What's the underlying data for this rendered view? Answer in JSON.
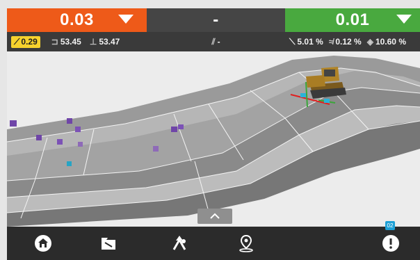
{
  "header": {
    "left": {
      "main_value": "0.03",
      "sub": {
        "badge_value": "0.29",
        "value_a": "53.45",
        "value_b": "53.47"
      },
      "color": "#ee5a19"
    },
    "middle": {
      "main_value": "-",
      "sub_value": "-"
    },
    "right": {
      "main_value": "0.01",
      "sub": {
        "value_a": "5.01 %",
        "value_b": "0.12 %",
        "value_c": "10.60 %"
      },
      "color": "#49a93f"
    }
  },
  "bottom_nav": {
    "items": [
      "home-icon",
      "folder-icon",
      "route-icon",
      "map-pin-icon",
      "alert-icon"
    ],
    "notification_count": "02"
  },
  "scene": {
    "machine": "bulldozer"
  }
}
